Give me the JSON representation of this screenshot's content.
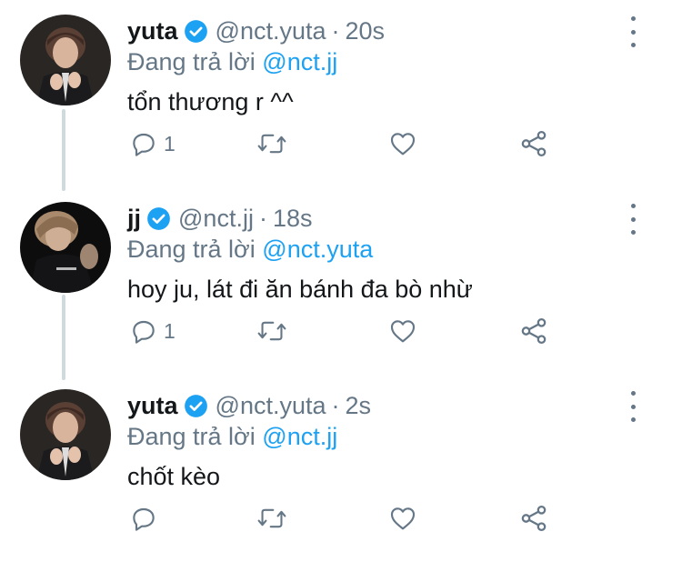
{
  "tweets": [
    {
      "name": "yuta",
      "handle": "@nct.yuta",
      "separator": "·",
      "time": "20s",
      "reply_prefix": "Đang trả lời",
      "reply_to": "@nct.jj",
      "text": "tổn thương r ^^",
      "reply_count": "1",
      "avatar": "yuta-avatar"
    },
    {
      "name": "jj",
      "handle": "@nct.jj",
      "separator": "·",
      "time": "18s",
      "reply_prefix": "Đang trả lời",
      "reply_to": "@nct.yuta",
      "text": "hoy ju, lát đi ăn bánh đa bò nhừ",
      "reply_count": "1",
      "avatar": "jj-avatar"
    },
    {
      "name": "yuta",
      "handle": "@nct.yuta",
      "separator": "·",
      "time": "2s",
      "reply_prefix": "Đang trả lời",
      "reply_to": "@nct.jj",
      "text": "chốt kèo",
      "reply_count": "",
      "avatar": "yuta-avatar"
    }
  ],
  "colors": {
    "verified": "#1da1f2",
    "link": "#1da1f2",
    "muted": "#657786",
    "thread_line": "#cfd9de"
  },
  "icons": [
    "verified-icon",
    "more-icon",
    "reply-icon",
    "retweet-icon",
    "like-icon",
    "share-icon"
  ]
}
